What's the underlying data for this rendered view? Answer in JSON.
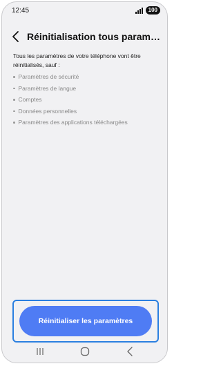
{
  "status_bar": {
    "time": "12:45",
    "battery": "100"
  },
  "header": {
    "title": "Réinitialisation tous paramètres"
  },
  "content": {
    "intro": "Tous les paramètres de votre téléphone vont être réinitialisés, sauf :",
    "exceptions": [
      "Paramètres de sécurité",
      "Paramètres de langue",
      "Comptes",
      "Données personnelles",
      "Paramètres des applications téléchargées"
    ]
  },
  "action": {
    "reset_label": "Réinitialiser les paramètres",
    "accent_color": "#4f7cf4",
    "highlight_color": "#2a7fe0"
  },
  "icons": {
    "back": "chevron-left-icon",
    "signal": "signal-icon",
    "nav_recents": "recents-icon",
    "nav_home": "home-icon",
    "nav_back": "nav-back-icon"
  }
}
